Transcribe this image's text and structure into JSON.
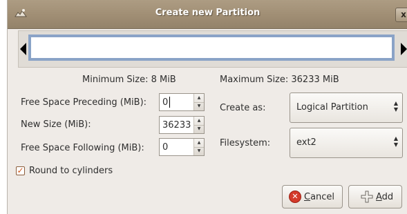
{
  "window": {
    "title": "Create new Partition",
    "close_glyph": "x"
  },
  "graph": {
    "left_arrow_icon": "triangle-left-icon",
    "right_arrow_icon": "triangle-right-icon"
  },
  "sizes": {
    "minimum_label": "Minimum Size: 8 MiB",
    "maximum_label": "Maximum Size: 36233 MiB"
  },
  "fields": {
    "free_preceding": {
      "label": "Free Space Preceding (MiB):",
      "value": "0"
    },
    "new_size": {
      "label": "New Size (MiB):",
      "value": "36233"
    },
    "free_following": {
      "label": "Free Space Following (MiB):",
      "value": "0"
    }
  },
  "create_as": {
    "label": "Create as:",
    "selected": "Logical Partition"
  },
  "filesystem": {
    "label": "Filesystem:",
    "selected": "ext2"
  },
  "round_cylinders": {
    "label": "Round to cylinders",
    "checked": true
  },
  "buttons": {
    "cancel_mnemonic": "C",
    "cancel_rest": "ancel",
    "add_mnemonic": "A",
    "add_rest": "dd"
  },
  "colors": {
    "titlebar": "#a08e74",
    "partition_bar_border": "#8aa3c7",
    "checkbox_check": "#d1571b",
    "cancel_icon": "#d43a2a"
  }
}
